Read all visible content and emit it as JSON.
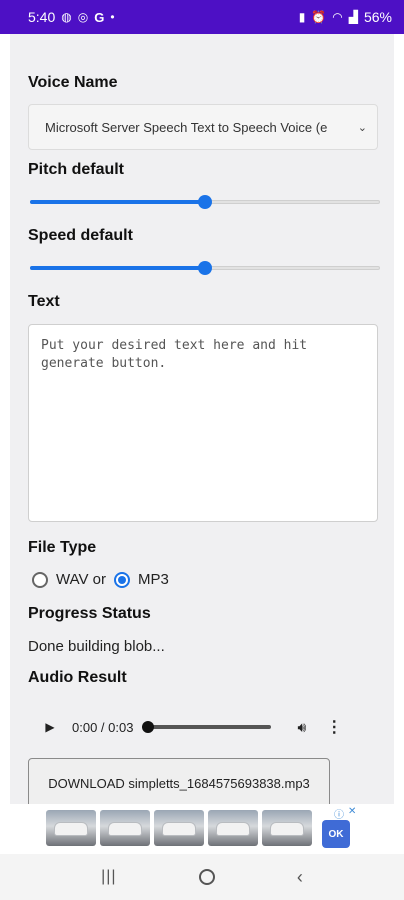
{
  "status_bar": {
    "time": "5:40",
    "left_icons": [
      "globe-icon",
      "whatsapp-icon",
      "google-icon",
      "dot-icon"
    ],
    "right_icons": [
      "battery-saver-icon",
      "alarm-icon",
      "wifi-icon",
      "signal-icon"
    ],
    "battery": "56%"
  },
  "form": {
    "voice_label": "Voice Name",
    "voice_value": "Microsoft Server Speech Text to Speech Voice (e",
    "pitch_label": "Pitch default",
    "pitch_value": 0.5,
    "speed_label": "Speed default",
    "speed_value": 0.5,
    "text_label": "Text",
    "text_placeholder": "Put your desired text here and hit generate button.",
    "filetype_label": "File Type",
    "filetype_options": [
      "WAV or",
      "MP3"
    ],
    "filetype_selected": "MP3",
    "progress_label": "Progress Status",
    "progress_text": "Done building blob...",
    "audio_label": "Audio Result",
    "audio_time": "0:00 / 0:03",
    "download_label": "DOWNLOAD simpletts_1684575693838.mp3"
  },
  "ad": {
    "adchoices": [
      "ⓘ",
      "✕"
    ],
    "logo_text": "OK"
  },
  "colors": {
    "status_bar": "#4d10c5",
    "accent": "#1a73e8",
    "page_bg": "#f0f0f2"
  }
}
